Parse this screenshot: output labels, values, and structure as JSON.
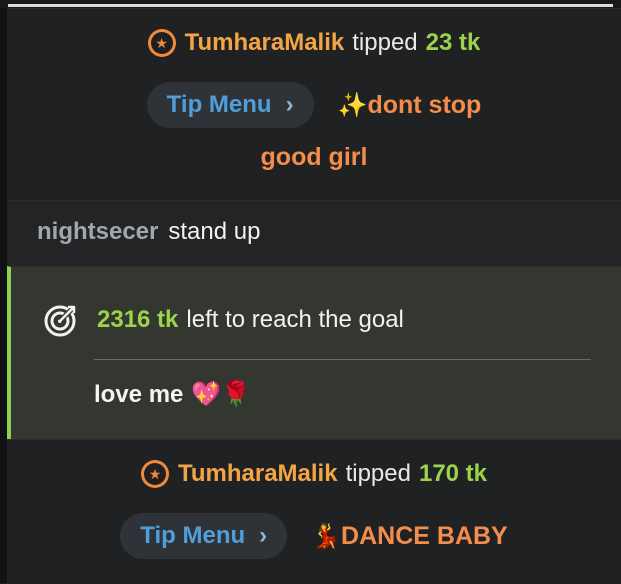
{
  "tip_1": {
    "username": "TumharaMalik",
    "action": "tipped",
    "amount": "23 tk",
    "menu_button": "Tip Menu",
    "menu_note_line1_prefix": "✨",
    "menu_note_line1": "dont stop",
    "menu_note_line2": "good girl"
  },
  "message": {
    "username": "nightsecer",
    "text": "stand up"
  },
  "goal": {
    "amount": "2316 tk",
    "text": "left to reach the goal",
    "description": "love me",
    "description_emojis": "💖🌹"
  },
  "tip_2": {
    "username": "TumharaMalik",
    "action": "tipped",
    "amount": "170 tk",
    "menu_button": "Tip Menu",
    "menu_note_prefix": "💃",
    "menu_note": "DANCE BABY"
  },
  "icons": {
    "star_badge": "star-badge-icon",
    "chevron": "chevron-right-icon",
    "target": "target-icon"
  },
  "colors": {
    "username": "#f2a545",
    "amount": "#9bd34b",
    "tip_menu_text": "#4f9ed9",
    "menu_note": "#f28d4b",
    "goal_accent": "#8fd14f"
  }
}
